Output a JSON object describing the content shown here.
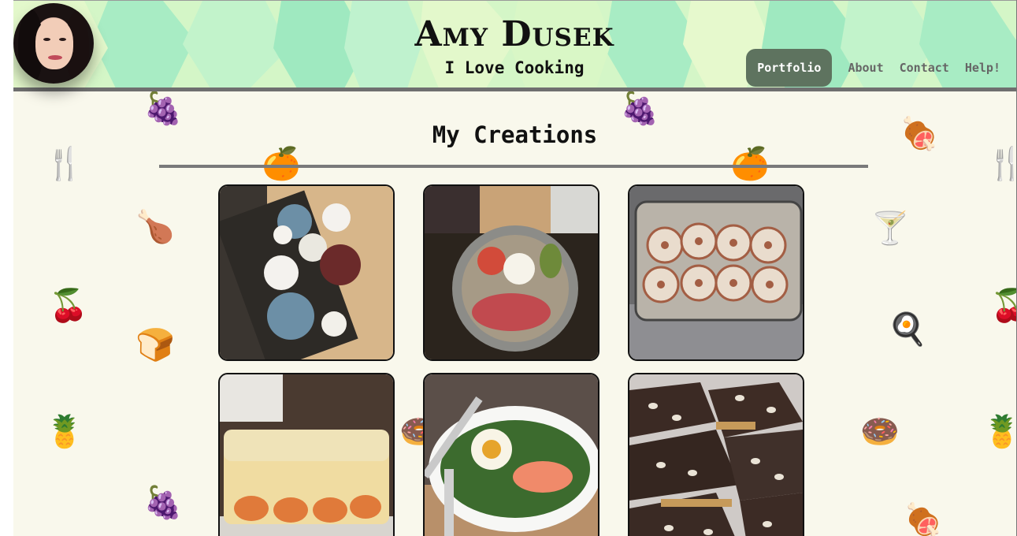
{
  "site": {
    "title": "Amy Dusek",
    "subtitle": "I Love Cooking"
  },
  "nav": {
    "items": [
      {
        "label": "Portfolio",
        "active": true
      },
      {
        "label": "About",
        "active": false
      },
      {
        "label": "Contact",
        "active": false
      },
      {
        "label": "Help!",
        "active": false
      }
    ]
  },
  "main": {
    "heading": "My Creations"
  },
  "colors": {
    "header_bg": "#d6f5c8",
    "page_bg": "#f9f8ec",
    "nav_active_bg": "#5e735f",
    "rule": "#7a7a7a"
  },
  "gallery": {
    "photos": [
      {
        "subject": "breakfast-table"
      },
      {
        "subject": "plate-with-egg-and-meat"
      },
      {
        "subject": "cinnamon-rolls"
      },
      {
        "subject": "custard-dessert"
      },
      {
        "subject": "salad-with-salmon"
      },
      {
        "subject": "chocolate-almond-toffee"
      }
    ]
  }
}
